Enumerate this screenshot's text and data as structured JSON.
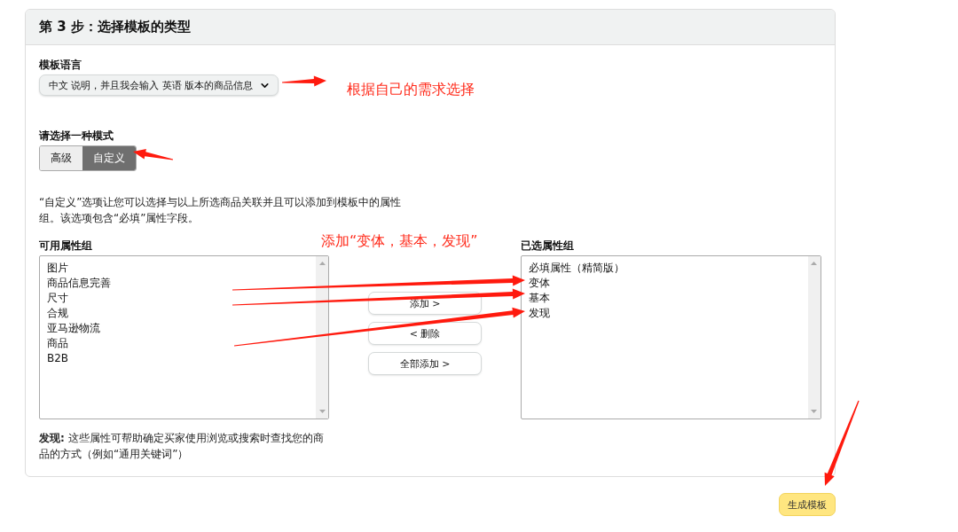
{
  "header": {
    "title": "第 3 步：选择模板的类型"
  },
  "language": {
    "label": "模板语言",
    "value": "中文 说明，并且我会输入 英语 版本的商品信息"
  },
  "mode": {
    "label": "请选择一种模式",
    "options": [
      {
        "label": "高级",
        "selected": false
      },
      {
        "label": "自定义",
        "selected": true
      }
    ]
  },
  "description": "“自定义”选项让您可以选择与以上所选商品关联并且可以添加到模板中的属性组。该选项包含“必填”属性字段。",
  "available": {
    "label": "可用属性组",
    "items": [
      "图片",
      "商品信息完善",
      "尺寸",
      "合规",
      "亚马逊物流",
      "商品",
      "B2B"
    ]
  },
  "actions": [
    "添加 >",
    "< 删除",
    "全部添加 >"
  ],
  "selected_groups": {
    "label": "已选属性组",
    "items": [
      "必填属性（精简版）",
      "变体",
      "基本",
      "发现"
    ]
  },
  "note": "**发现:** 这些属性可帮助确定买家使用浏览或搜索时查找您的商品的方式（例如“通用关键词”）",
  "generate_button": "生成模板",
  "annotations": [
    {
      "text": "根据自己的需求选择"
    },
    {
      "text": "添加“变体，基本，发现”"
    }
  ]
}
